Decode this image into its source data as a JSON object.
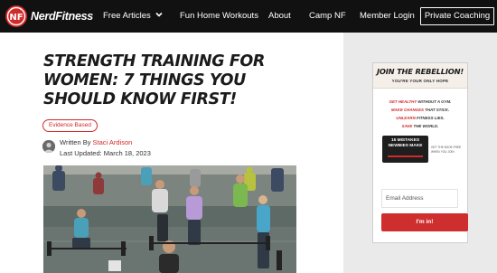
{
  "nav": {
    "logo_text": "NerdFitness",
    "items": [
      "Free Articles",
      "Fun Home Workouts",
      "About",
      "Camp NF",
      "Member Login"
    ],
    "cta": "Private Coaching"
  },
  "article": {
    "title": "STRENGTH TRAINING FOR WOMEN: 7 THINGS YOU SHOULD KNOW FIRST!",
    "badge": "Evidence Based",
    "written_by": "Written By",
    "author": "Staci Ardison",
    "last_updated": "Last Updated: March 18, 2023"
  },
  "promo": {
    "title": "JOIN THE REBELLION!",
    "subtitle": "YOU'RE YOUR ONLY HOPE",
    "lines": [
      {
        "red": "GET HEALTHY",
        "rest": " WITHOUT A GYM."
      },
      {
        "red": "MAKE CHANGES",
        "rest": " THAT STICK."
      },
      {
        "red": "UNLEARN",
        "rest": " FITNESS LIES."
      },
      {
        "red": "SAVE",
        "rest": " THE WORLD."
      }
    ],
    "book_title_1": "15 MISTAKES",
    "book_title_2": "NEWBIES MAKE",
    "book_note": "GET THE BOOK FREE WHEN YOU JOIN",
    "email_placeholder": "Email Address",
    "submit": "I'm in!"
  },
  "colors": {
    "accent": "#d12a2a",
    "nav_bg": "#111111",
    "sidebar_bg": "#eaeaea"
  }
}
